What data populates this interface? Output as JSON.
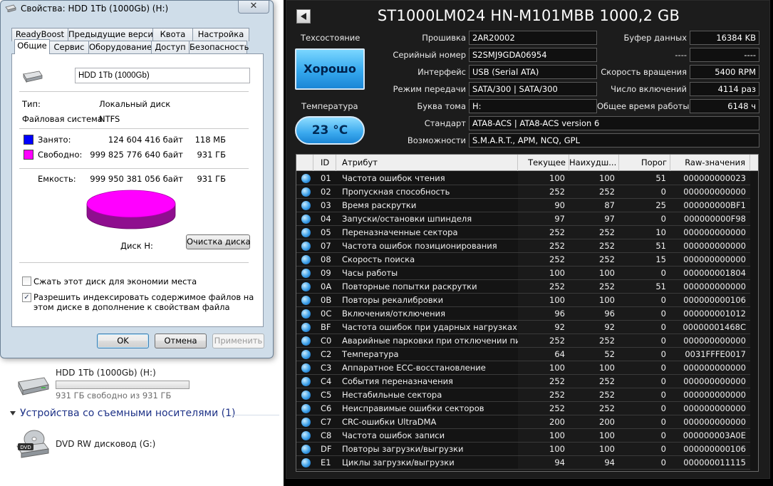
{
  "dialog": {
    "title": "Свойства: HDD 1Tb (1000Gb) (H:)",
    "close_glyph": "✕",
    "tabs_row1": [
      "ReadyBoost",
      "Предыдущие версии",
      "Квота",
      "Настройка"
    ],
    "tabs_row2": [
      "Общие",
      "Сервис",
      "Оборудование",
      "Доступ",
      "Безопасность"
    ],
    "drive_label_value": "HDD 1Tb (1000Gb)",
    "type_label": "Тип:",
    "type_value": "Локальный диск",
    "fs_label": "Файловая система:",
    "fs_value": "NTFS",
    "used_label": "Занято:",
    "used_bytes": "124 604 416 байт",
    "used_size": "118 МБ",
    "free_label": "Свободно:",
    "free_bytes": "999 825 776 640 байт",
    "free_size": "931 ГБ",
    "capacity_label": "Емкость:",
    "capacity_bytes": "999 950 381 056 байт",
    "capacity_size": "931 ГБ",
    "disk_label": "Диск H:",
    "cleanup_button": "Очистка диска",
    "compress_label": "Сжать этот диск для экономии места",
    "index_label": "Разрешить индексировать содержимое файлов на этом диске в дополнение к свойствам файла",
    "compress_checked": false,
    "index_checked": true,
    "ok_button": "OK",
    "cancel_button": "Отмена",
    "apply_button": "Применить",
    "colors": {
      "used": "#0000ff",
      "free": "#ff00ff"
    }
  },
  "explorer": {
    "drive_name": "HDD 1Tb (1000Gb) (H:)",
    "drive_free_text": "931 ГБ свободно из 931 ГБ",
    "section_title": "Устройства со съемными носителями (1)",
    "dvd_name": "DVD RW дисковод (G:)",
    "dvd_badge": "DVD"
  },
  "cdi": {
    "model": "ST1000LM024 HN-M101MBB 1000,2 GB",
    "health_label": "Техсостояние",
    "health_value": "Хорошо",
    "temp_label": "Температура",
    "temp_value": "23 °C",
    "firmware_label": "Прошивка",
    "firmware": "2AR20002",
    "serial_label": "Серийный номер",
    "serial": "S2SMJ9GDA06954",
    "interface_label": "Интерфейс",
    "interface": "USB (Serial ATA)",
    "transfer_label": "Режим передачи",
    "transfer": "SATA/300 | SATA/300",
    "letter_label": "Буква тома",
    "letter": "H:",
    "standard_label": "Стандарт",
    "standard": "ATA8-ACS | ATA8-ACS version 6",
    "features_label": "Возможности",
    "features": "S.M.A.R.T., APM, NCQ, GPL",
    "buffer_label": "Буфер данных",
    "buffer": "16384 KB",
    "blank_label": "----",
    "blank_value": "----",
    "rpm_label": "Скорость вращения",
    "rpm": "5400 RPM",
    "power_count_label": "Число включений",
    "power_count": "4114 раз",
    "power_hours_label": "Общее время работы",
    "power_hours": "6148 ч",
    "smart_headers": [
      "ID",
      "Атрибут",
      "Текущее",
      "Наихудш...",
      "Порог",
      "Raw-значения"
    ],
    "smart_rows": [
      [
        "01",
        "Частота ошибок чтения",
        "100",
        "100",
        "51",
        "000000000023"
      ],
      [
        "02",
        "Пропускная способность",
        "252",
        "252",
        "0",
        "000000000000"
      ],
      [
        "03",
        "Время раскрутки",
        "90",
        "87",
        "25",
        "000000000BF1"
      ],
      [
        "04",
        "Запуски/остановки шпинделя",
        "97",
        "97",
        "0",
        "000000000F98"
      ],
      [
        "05",
        "Переназначенные сектора",
        "252",
        "252",
        "10",
        "000000000000"
      ],
      [
        "07",
        "Частота ошибок позиционирования",
        "252",
        "252",
        "51",
        "000000000000"
      ],
      [
        "08",
        "Скорость поиска",
        "252",
        "252",
        "15",
        "000000000000"
      ],
      [
        "09",
        "Часы работы",
        "100",
        "100",
        "0",
        "000000001804"
      ],
      [
        "0A",
        "Повторные попытки раскрутки",
        "252",
        "252",
        "51",
        "000000000000"
      ],
      [
        "0B",
        "Повторы рекалибровки",
        "100",
        "100",
        "0",
        "000000000106"
      ],
      [
        "0C",
        "Включения/отключения",
        "96",
        "96",
        "0",
        "000000001012"
      ],
      [
        "BF",
        "Частота ошибок при ударных нагрузках",
        "92",
        "92",
        "0",
        "00000001468C"
      ],
      [
        "C0",
        "Аварийные парковки при отключении пи...",
        "252",
        "252",
        "0",
        "000000000000"
      ],
      [
        "C2",
        "Температура",
        "64",
        "52",
        "0",
        "0031FFFE0017"
      ],
      [
        "C3",
        "Аппаратное ECC-восстановление",
        "100",
        "100",
        "0",
        "000000000000"
      ],
      [
        "C4",
        "События переназначения",
        "252",
        "252",
        "0",
        "000000000000"
      ],
      [
        "C5",
        "Нестабильные сектора",
        "252",
        "252",
        "0",
        "000000000000"
      ],
      [
        "C6",
        "Неисправимые ошибки секторов",
        "252",
        "252",
        "0",
        "000000000000"
      ],
      [
        "C7",
        "CRC-ошибки UltraDMA",
        "200",
        "200",
        "0",
        "000000000000"
      ],
      [
        "C8",
        "Частота ошибок записи",
        "100",
        "100",
        "0",
        "000000003A0E"
      ],
      [
        "DF",
        "Повторы загрузки/выгрузки",
        "100",
        "100",
        "0",
        "000000000106"
      ],
      [
        "E1",
        "Циклы загрузки/выгрузки",
        "94",
        "94",
        "0",
        "000000011115"
      ]
    ]
  }
}
